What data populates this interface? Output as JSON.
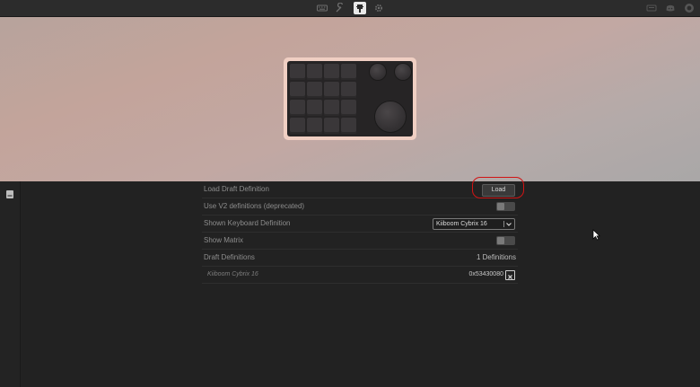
{
  "topbar": {
    "icons": [
      {
        "name": "keyboard-icon",
        "active": false
      },
      {
        "name": "settings-icon",
        "active": false
      },
      {
        "name": "debug-icon",
        "active": true
      },
      {
        "name": "gear-icon",
        "active": false
      }
    ],
    "right_icons": [
      "download-icon",
      "discord-icon",
      "github-icon"
    ]
  },
  "colors": {
    "accent_ring": "#d11414",
    "keyboard_case": "#f0cfc3"
  },
  "settings": {
    "load_draft": {
      "label": "Load Draft Definition",
      "button": "Load"
    },
    "use_v2": {
      "label": "Use V2 definitions (deprecated)",
      "enabled": false
    },
    "shown_definition": {
      "label": "Shown Keyboard Definition",
      "selected": "Kiiboom Cybrix 16"
    },
    "show_matrix": {
      "label": "Show Matrix",
      "enabled": false
    },
    "draft_definitions": {
      "label": "Draft Definitions",
      "count": "1 Definitions"
    },
    "draft_items": [
      {
        "name": "Kiiboom Cybrix 16",
        "id": "0x53430080"
      }
    ]
  }
}
